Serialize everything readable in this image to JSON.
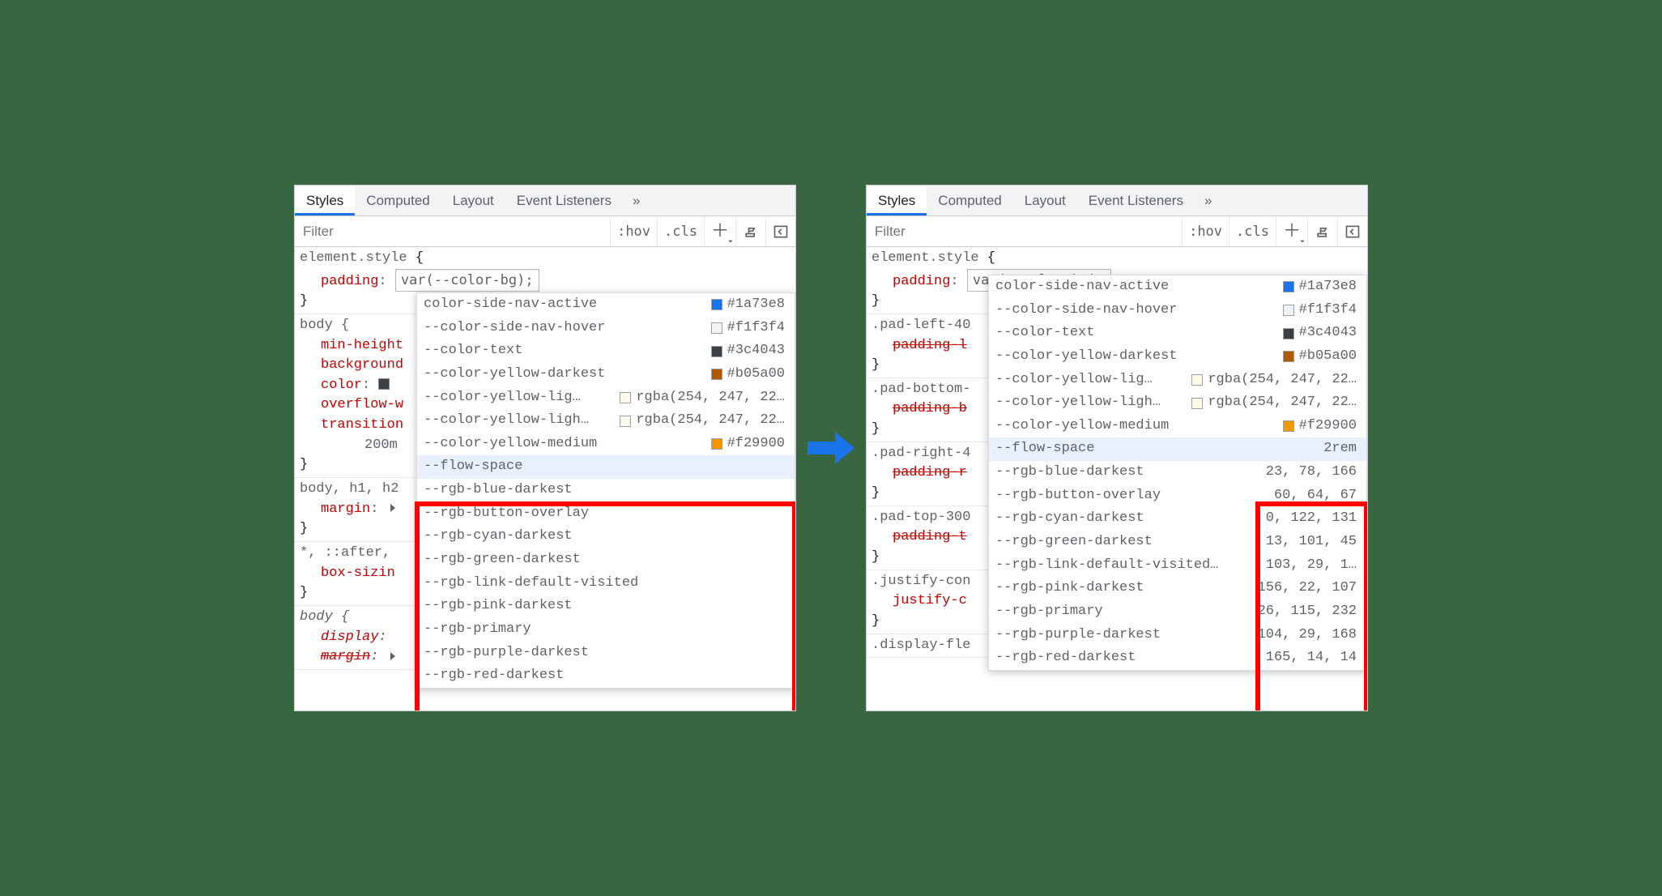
{
  "tabs": [
    "Styles",
    "Computed",
    "Layout",
    "Event Listeners"
  ],
  "filter_placeholder": "Filter",
  "toolbar": {
    "hov": ":hov",
    "cls": ".cls"
  },
  "element_style": {
    "selector": "element.style",
    "prop": "padding",
    "edit_value": "var(--color-bg);"
  },
  "left_rules": [
    {
      "selector": "body {",
      "decls": [
        {
          "p": "min-height"
        },
        {
          "p": "background"
        },
        {
          "p": "color",
          "swatch": "#3c4043"
        },
        {
          "p": "overflow-w"
        },
        {
          "p": "transition"
        }
      ],
      "tail": "200m",
      "close": "}"
    },
    {
      "selector": "body, h1, h2",
      "decls": [
        {
          "p": "margin",
          "val_icon": "tri"
        }
      ],
      "close": "}"
    },
    {
      "selector": "*, ::after,",
      "decls": [
        {
          "p": "box-sizin"
        }
      ],
      "close": "}"
    },
    {
      "selector": "body {",
      "italic": true,
      "decls": [
        {
          "p": "display",
          "italic": true
        },
        {
          "p": "margin",
          "italic": true,
          "struck": true,
          "val_icon": "tri"
        }
      ]
    }
  ],
  "right_rules": [
    {
      "selector": ".pad-left-40",
      "decls": [
        {
          "p": "padding-l",
          "struck": true
        }
      ],
      "close": "}"
    },
    {
      "selector": ".pad-bottom-",
      "decls": [
        {
          "p": "padding-b",
          "struck": true
        }
      ],
      "close": "}"
    },
    {
      "selector": ".pad-right-4",
      "decls": [
        {
          "p": "padding-r",
          "struck": true
        }
      ],
      "close": "}"
    },
    {
      "selector": ".pad-top-300",
      "decls": [
        {
          "p": "padding-t",
          "struck": true
        }
      ],
      "close": "}"
    },
    {
      "selector": ".justify-con",
      "decls": [
        {
          "p": "justify-c"
        }
      ],
      "close": "}"
    },
    {
      "selector": ".display-fle"
    }
  ],
  "ac_colors_top": [
    {
      "name": "color-side-nav-active",
      "sw": "#1a73e8",
      "val": "#1a73e8",
      "partial": true
    },
    {
      "name": "--color-side-nav-hover",
      "sw": "#f1f3f4",
      "val": "#f1f3f4"
    },
    {
      "name": "--color-text",
      "sw": "#3c4043",
      "val": "#3c4043"
    },
    {
      "name": "--color-yellow-darkest",
      "sw": "#b05a00",
      "val": "#b05a00"
    },
    {
      "name": "--color-yellow-lig…",
      "sw": "rgba(254,247,220,0.6)",
      "val": "rgba(254, 247, 22…"
    },
    {
      "name": "--color-yellow-ligh…",
      "sw": "rgba(254,247,220,0.6)",
      "val": "rgba(254, 247, 22…"
    },
    {
      "name": "--color-yellow-medium",
      "sw": "#f29900",
      "val": "#f29900"
    }
  ],
  "ac_bottom_left": [
    {
      "name": "--flow-space",
      "hl": true
    },
    {
      "name": "--rgb-blue-darkest"
    },
    {
      "name": "--rgb-button-overlay"
    },
    {
      "name": "--rgb-cyan-darkest"
    },
    {
      "name": "--rgb-green-darkest"
    },
    {
      "name": "--rgb-link-default-visited"
    },
    {
      "name": "--rgb-pink-darkest"
    },
    {
      "name": "--rgb-primary"
    },
    {
      "name": "--rgb-purple-darkest"
    },
    {
      "name": "--rgb-red-darkest"
    }
  ],
  "ac_bottom_right": [
    {
      "name": "--flow-space",
      "val": "2rem",
      "hl": true
    },
    {
      "name": "--rgb-blue-darkest",
      "val": "23, 78, 166"
    },
    {
      "name": "--rgb-button-overlay",
      "val": "60, 64, 67"
    },
    {
      "name": "--rgb-cyan-darkest",
      "val": "0, 122, 131"
    },
    {
      "name": "--rgb-green-darkest",
      "val": "13, 101, 45"
    },
    {
      "name": "--rgb-link-default-visited…",
      "val": "103, 29, 1…"
    },
    {
      "name": "--rgb-pink-darkest",
      "val": "156, 22, 107"
    },
    {
      "name": "--rgb-primary",
      "val": "26, 115, 232"
    },
    {
      "name": "--rgb-purple-darkest",
      "val": "104, 29, 168"
    },
    {
      "name": "--rgb-red-darkest",
      "val": "165, 14, 14"
    }
  ]
}
